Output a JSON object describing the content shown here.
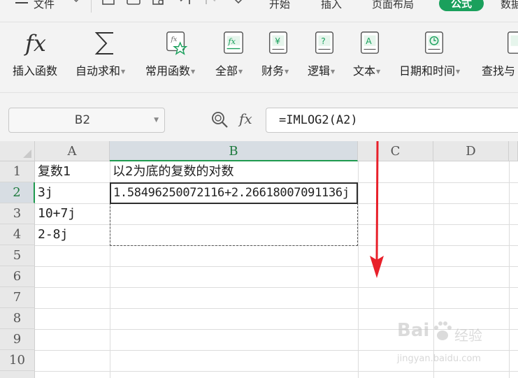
{
  "menu": {
    "file_label": "文件",
    "tabs": [
      "开始",
      "插入",
      "页面布局",
      "公式",
      "数据"
    ],
    "active_tab": "公式",
    "accent_color": "#1aa05c"
  },
  "ribbon": {
    "insert_function": "插入函数",
    "auto_sum": "自动求和",
    "common_functions": "常用函数",
    "all": "全部",
    "finance": "财务",
    "logic": "逻辑",
    "text": "文本",
    "date_time": "日期和时间",
    "lookup": "查找与"
  },
  "formula_bar": {
    "name_box": "B2",
    "fx_symbol": "fx",
    "formula": "=IMLOG2(A2)"
  },
  "grid": {
    "columns": [
      "A",
      "B",
      "C",
      "D"
    ],
    "active_column": "B",
    "rows": [
      "1",
      "2",
      "3",
      "4",
      "5",
      "6",
      "7",
      "8",
      "9",
      "10"
    ],
    "active_row": "2",
    "cells": {
      "A1": "复数1",
      "B1": "以2为底的复数的对数",
      "A2": "3j",
      "B2": "1.58496250072116+2.26618007091136j",
      "A3": "10+7j",
      "A4": "2-8j"
    }
  },
  "annotation": {
    "arrow_color": "#e8202a"
  },
  "watermark": {
    "brand": "Bai",
    "brand2": "经验",
    "url": "jingyan.baidu.com"
  }
}
